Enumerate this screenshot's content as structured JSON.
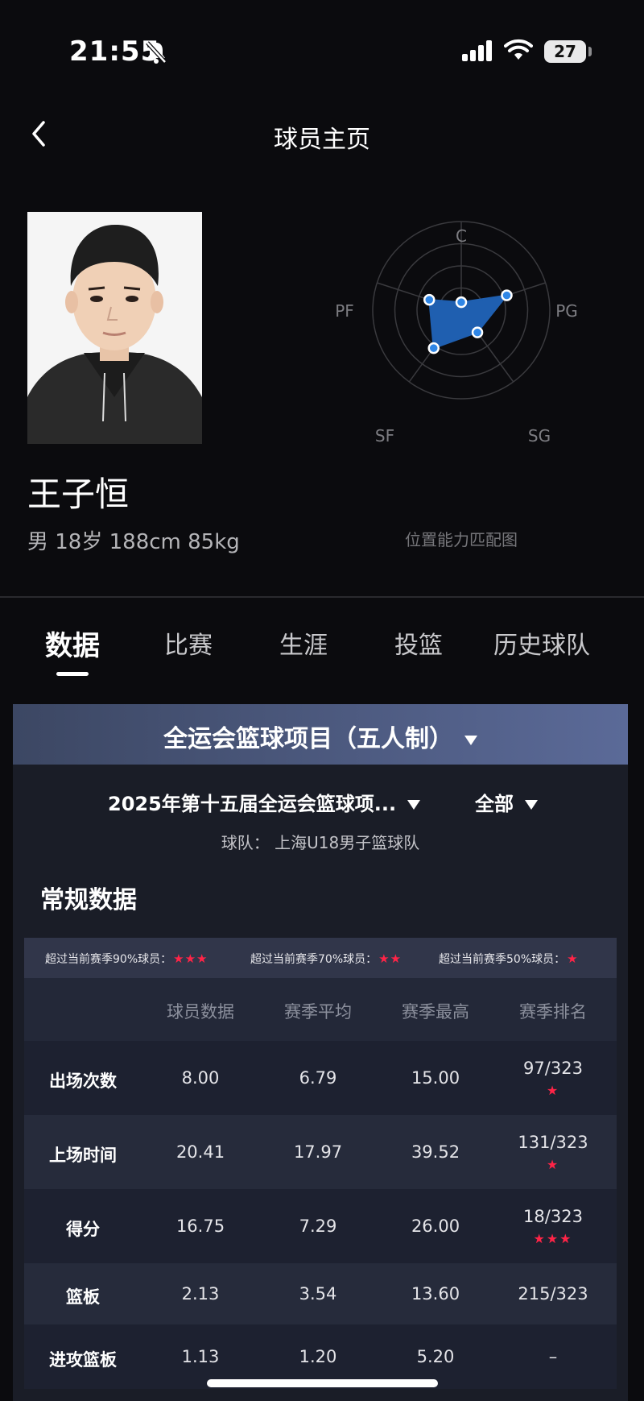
{
  "status_bar": {
    "time": "21:55",
    "battery": "27"
  },
  "nav": {
    "title": "球员主页"
  },
  "player": {
    "name": "王子恒",
    "meta": "男 18岁 188cm 85kg"
  },
  "radar": {
    "caption": "位置能力匹配图",
    "labels": {
      "C": "C",
      "PG": "PG",
      "SG": "SG",
      "SF": "SF",
      "PF": "PF"
    },
    "values": {
      "C": 0.09,
      "PG": 0.54,
      "SG": 0.31,
      "SF": 0.53,
      "PF": 0.38
    }
  },
  "tabs": [
    "数据",
    "比赛",
    "生涯",
    "投篮",
    "历史球队"
  ],
  "card": {
    "competition": "全运会篮球项目（五人制）",
    "season": "2025年第十五届全运会篮球项...",
    "scope": "全部",
    "team": "球队：  上海U18男子篮球队",
    "section_title": "常规数据",
    "legend": [
      {
        "text": "超过当前赛季90%球员：",
        "stars": "★★★"
      },
      {
        "text": "超过当前赛季70%球员：",
        "stars": "★★"
      },
      {
        "text": "超过当前赛季50%球员：",
        "stars": "★"
      }
    ],
    "headers": [
      "",
      "球员数据",
      "赛季平均",
      "赛季最高",
      "赛季排名"
    ],
    "rows": [
      {
        "label": "出场次数",
        "player": "8.00",
        "avg": "6.79",
        "max": "15.00",
        "rank": "97/323",
        "stars": "★"
      },
      {
        "label": "上场时间",
        "player": "20.41",
        "avg": "17.97",
        "max": "39.52",
        "rank": "131/323",
        "stars": "★"
      },
      {
        "label": "得分",
        "player": "16.75",
        "avg": "7.29",
        "max": "26.00",
        "rank": "18/323",
        "stars": "★★★"
      },
      {
        "label": "篮板",
        "player": "2.13",
        "avg": "3.54",
        "max": "13.60",
        "rank": "215/323",
        "stars": ""
      },
      {
        "label": "进攻篮板",
        "player": "1.13",
        "avg": "1.20",
        "max": "5.20",
        "rank": "–",
        "stars": ""
      }
    ]
  },
  "colors": {
    "accent_star": "#ff2447",
    "radar_fill": "#1f5fb0",
    "radar_dot": "#2f86e6"
  },
  "icons": [
    "mute-bell-icon",
    "signal-icon",
    "wifi-icon",
    "battery-icon",
    "back-chevron-icon",
    "dropdown-triangle-icon",
    "star-icon"
  ]
}
